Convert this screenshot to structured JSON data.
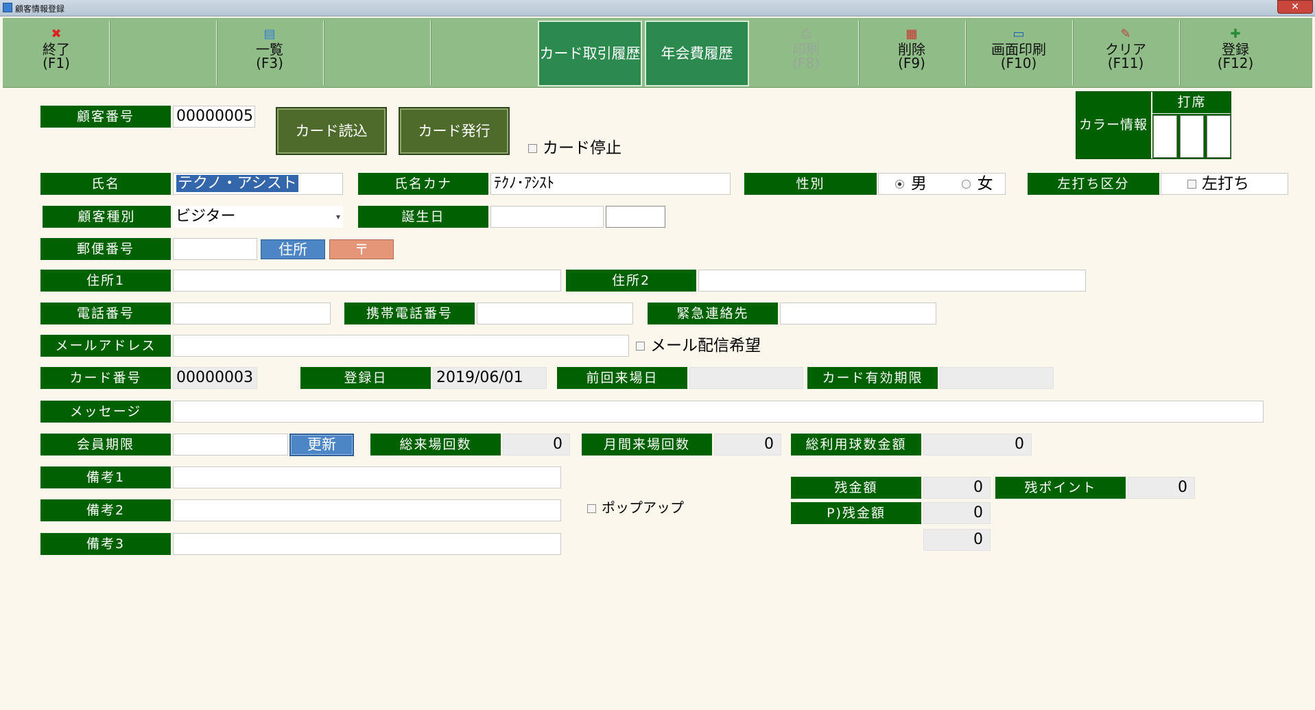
{
  "window": {
    "title": "顧客情報登録",
    "close_label": "✕"
  },
  "toolbar": {
    "exit": {
      "label": "終了",
      "key": "(F1)"
    },
    "list": {
      "label": "一覧",
      "key": "(F3)"
    },
    "card_history": "カード取引履歴",
    "annual_fee_history": "年会費履歴",
    "print": {
      "label": "印刷",
      "key": "(F8)"
    },
    "delete": {
      "label": "削除",
      "key": "(F9)"
    },
    "screen_print": {
      "label": "画面印刷",
      "key": "(F10)"
    },
    "clear": {
      "label": "クリア",
      "key": "(F11)"
    },
    "register": {
      "label": "登録",
      "key": "(F12)"
    }
  },
  "form": {
    "customer_no": {
      "label": "顧客番号",
      "value": "00000005"
    },
    "card_read_button": "カード読込",
    "card_issue_button": "カード発行",
    "card_stop": "カード停止",
    "color_info": {
      "label": "カラー情報",
      "seat_label": "打席"
    },
    "name": {
      "label": "氏名",
      "value": "テクノ・アシスト"
    },
    "name_kana": {
      "label": "氏名カナ",
      "value": "ﾃｸﾉ･ｱｼｽﾄ"
    },
    "gender": {
      "label": "性別",
      "male": "男",
      "female": "女",
      "selected": "男"
    },
    "left_handed": {
      "label": "左打ち区分",
      "option": "左打ち"
    },
    "customer_type": {
      "label": "顧客種別",
      "value": "ビジター",
      "arrow": "▾"
    },
    "birthday": {
      "label": "誕生日",
      "value": "",
      "age": ""
    },
    "postal": {
      "label": "郵便番号",
      "value": "",
      "address_button": "住所",
      "postal_button": "〒"
    },
    "address1": {
      "label": "住所1",
      "value": ""
    },
    "address2": {
      "label": "住所2",
      "value": ""
    },
    "phone": {
      "label": "電話番号",
      "value": ""
    },
    "mobile": {
      "label": "携帯電話番号",
      "value": ""
    },
    "emergency": {
      "label": "緊急連絡先",
      "value": ""
    },
    "email": {
      "label": "メールアドレス",
      "value": "",
      "opt_in": "メール配信希望"
    },
    "card_no": {
      "label": "カード番号",
      "value": "00000003"
    },
    "register_date": {
      "label": "登録日",
      "value": "2019/06/01"
    },
    "last_visit": {
      "label": "前回来場日",
      "value": ""
    },
    "card_expiry": {
      "label": "カード有効期限",
      "value": ""
    },
    "message": {
      "label": "メッセージ",
      "value": ""
    },
    "member_expiry": {
      "label": "会員期限",
      "value": "",
      "renew_button": "更新"
    },
    "total_visits": {
      "label": "総来場回数",
      "value": "0"
    },
    "monthly_visits": {
      "label": "月間来場回数",
      "value": "0"
    },
    "total_ball_amount": {
      "label": "総利用球数金額",
      "value": "0"
    },
    "note1": {
      "label": "備考1",
      "value": ""
    },
    "note2": {
      "label": "備考2",
      "value": ""
    },
    "note3": {
      "label": "備考3",
      "value": ""
    },
    "popup": "ポップアップ",
    "balance": {
      "label": "残金額",
      "value": "0"
    },
    "points": {
      "label": "残ポイント",
      "value": "0"
    },
    "p_balance": {
      "label": "P)残金額",
      "value": "0"
    },
    "extra_value": "0"
  },
  "colors": {
    "label_bg": "#006100",
    "toolbar_bg": "#8fbc87",
    "page_bg": "#fbf7ec",
    "accent_button": "#2c8a4f"
  }
}
